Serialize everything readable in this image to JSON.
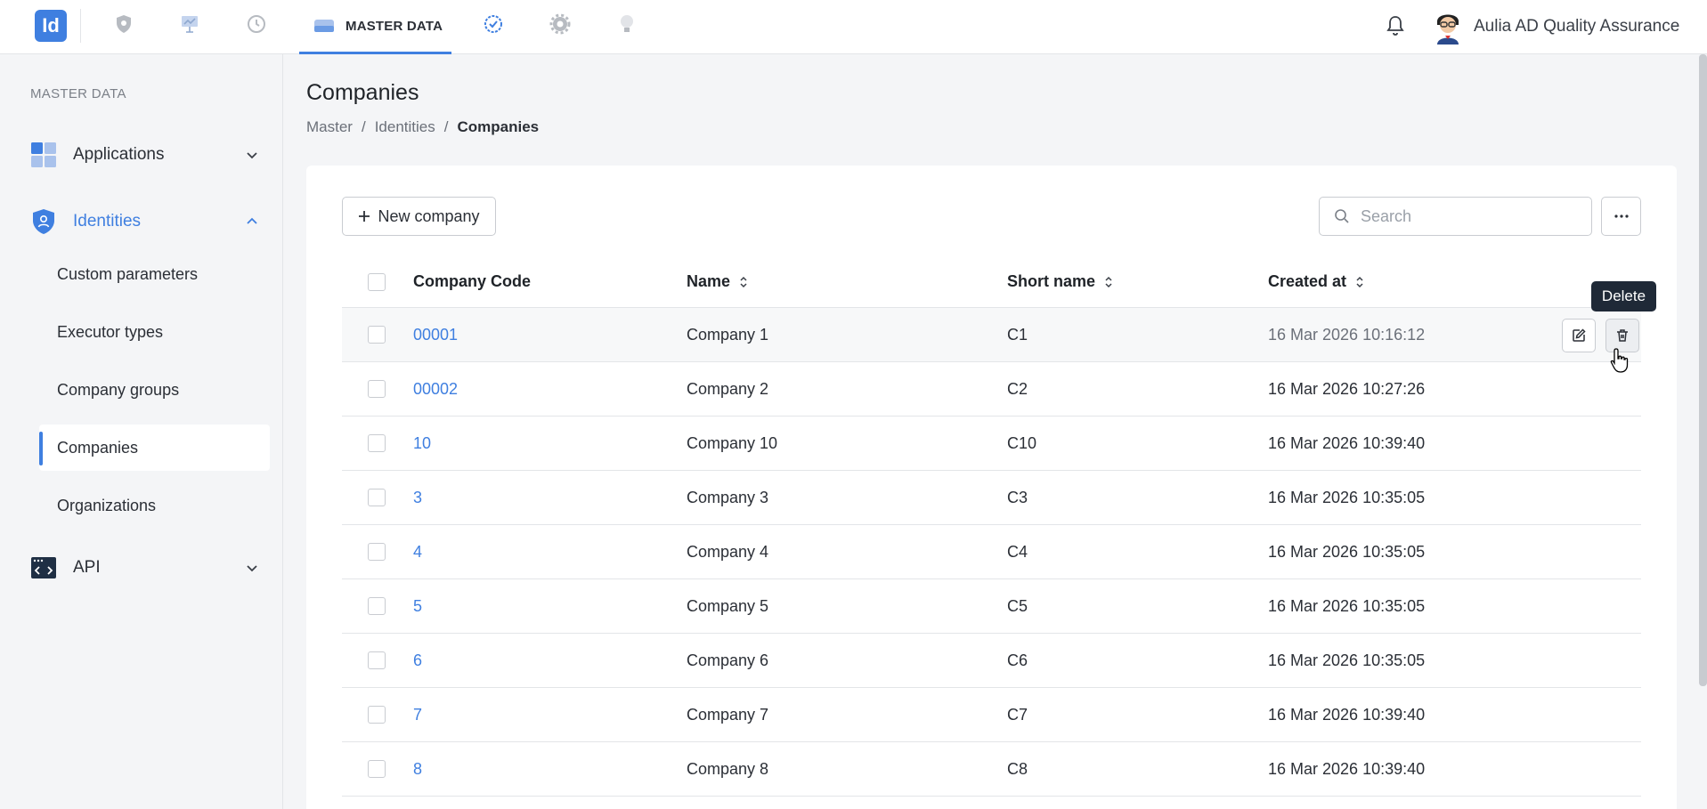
{
  "topbar": {
    "logo": "Id",
    "active_tab": "MASTER DATA",
    "username": "Aulia AD Quality Assurance",
    "nav_icons": [
      "shield-icon",
      "presentation-icon",
      "history-icon",
      "database-icon",
      "badge-check-icon",
      "gear-icon",
      "lightbulb-icon"
    ]
  },
  "sidebar": {
    "section": "MASTER DATA",
    "groups": {
      "applications": "Applications",
      "identities": "Identities",
      "api": "API"
    },
    "items": [
      "Custom parameters",
      "Executor types",
      "Company groups",
      "Companies",
      "Organizations"
    ]
  },
  "page": {
    "title": "Companies",
    "breadcrumb": [
      "Master",
      "Identities",
      "Companies"
    ]
  },
  "toolbar": {
    "new_label": "New company",
    "search_placeholder": "Search"
  },
  "table": {
    "columns": [
      "Company Code",
      "Name",
      "Short name",
      "Created at"
    ],
    "rows": [
      {
        "code": "00001",
        "name": "Company 1",
        "short": "C1",
        "created": "16 Mar 2026 10:16:12"
      },
      {
        "code": "00002",
        "name": "Company 2",
        "short": "C2",
        "created": "16 Mar 2026 10:27:26"
      },
      {
        "code": "10",
        "name": "Company 10",
        "short": "C10",
        "created": "16 Mar 2026 10:39:40"
      },
      {
        "code": "3",
        "name": "Company 3",
        "short": "C3",
        "created": "16 Mar 2026 10:35:05"
      },
      {
        "code": "4",
        "name": "Company 4",
        "short": "C4",
        "created": "16 Mar 2026 10:35:05"
      },
      {
        "code": "5",
        "name": "Company 5",
        "short": "C5",
        "created": "16 Mar 2026 10:35:05"
      },
      {
        "code": "6",
        "name": "Company 6",
        "short": "C6",
        "created": "16 Mar 2026 10:35:05"
      },
      {
        "code": "7",
        "name": "Company 7",
        "short": "C7",
        "created": "16 Mar 2026 10:39:40"
      },
      {
        "code": "8",
        "name": "Company 8",
        "short": "C8",
        "created": "16 Mar 2026 10:39:40"
      }
    ]
  },
  "tooltip": "Delete",
  "colors": {
    "accent": "#3f7fe0",
    "tooltip_bg": "#1f2937"
  }
}
